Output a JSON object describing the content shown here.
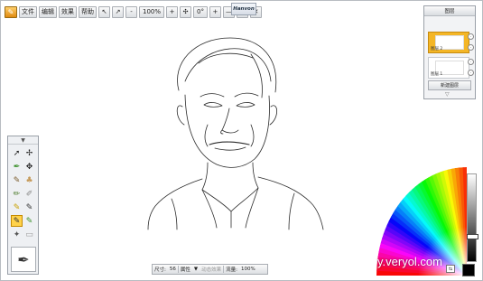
{
  "toolbar": {
    "app_icon": "app-logo-icon",
    "menu": [
      "文件",
      "编辑",
      "效果",
      "帮助"
    ],
    "zoom_minus": "-",
    "zoom_value": "100%",
    "zoom_plus": "+",
    "move": "✣",
    "rotation": "0°",
    "rotate_plus": "+",
    "minimize": "—",
    "maximize": "☐",
    "close": "✕"
  },
  "brand": "Hanvon",
  "layers_panel": {
    "title": "图层",
    "layers": [
      {
        "name": "图层 2",
        "active": true
      },
      {
        "name": "图层 1",
        "active": false
      }
    ],
    "new_layer": "新建图层",
    "collapse": "▽"
  },
  "status_bar": {
    "size_label": "尺寸:",
    "size_value": "56",
    "properties": "属性",
    "dropdown": "▼",
    "effect": "动态效果",
    "flow_label": "流量:",
    "flow_value": "100%"
  },
  "watermark": "y.veryol.com",
  "colors": {
    "accent": "#f4b626",
    "foreground": "#000000",
    "background": "#ffffff"
  }
}
